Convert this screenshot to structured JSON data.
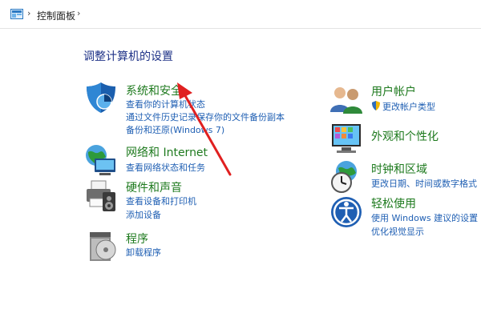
{
  "breadcrumb": {
    "path": "控制面板"
  },
  "page": {
    "title": "调整计算机的设置"
  },
  "categories": {
    "system_security": {
      "title": "系统和安全",
      "links": [
        "查看你的计算机状态",
        "通过文件历史记录保存你的文件备份副本",
        "备份和还原(Windows 7)"
      ]
    },
    "network": {
      "title": "网络和 Internet",
      "links": [
        "查看网络状态和任务"
      ]
    },
    "hardware": {
      "title": "硬件和声音",
      "links": [
        "查看设备和打印机",
        "添加设备"
      ]
    },
    "programs": {
      "title": "程序",
      "links": [
        "卸载程序"
      ]
    },
    "user_accounts": {
      "title": "用户帐户",
      "links": [
        "更改帐户类型"
      ]
    },
    "appearance": {
      "title": "外观和个性化",
      "links": []
    },
    "clock_region": {
      "title": "时钟和区域",
      "links": [
        "更改日期、时间或数字格式"
      ]
    },
    "ease_access": {
      "title": "轻松使用",
      "links": [
        "使用 Windows 建议的设置",
        "优化视觉显示"
      ]
    }
  },
  "colors": {
    "title": "#1e3287",
    "category": "#1e7a1e",
    "link": "#1f5fb3",
    "annotation_arrow": "#e02020"
  }
}
